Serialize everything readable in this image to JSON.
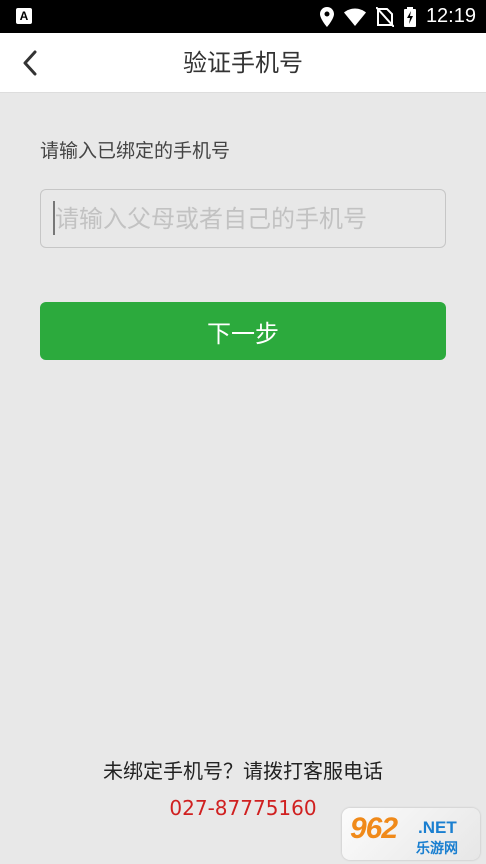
{
  "status_bar": {
    "left_icon": "A",
    "time": "12:19",
    "icons": [
      "location-icon",
      "wifi-icon",
      "no-sim-icon",
      "battery-charging-icon"
    ]
  },
  "header": {
    "title": "验证手机号",
    "back_icon": "back-chevron-icon"
  },
  "form": {
    "label": "请输入已绑定的手机号",
    "phone_value": "",
    "phone_placeholder": "请输入父母或者自己的手机号",
    "next_label": "下一步"
  },
  "footer": {
    "prompt": "未绑定手机号？请拨打客服电话",
    "hotline": "027-87775160"
  },
  "watermark": {
    "number": "962",
    "suffix": ".NET",
    "cn": "乐游网"
  },
  "colors": {
    "primary_green": "#2caa3d",
    "hotline_red": "#d02020",
    "background": "#e8e8e8"
  }
}
